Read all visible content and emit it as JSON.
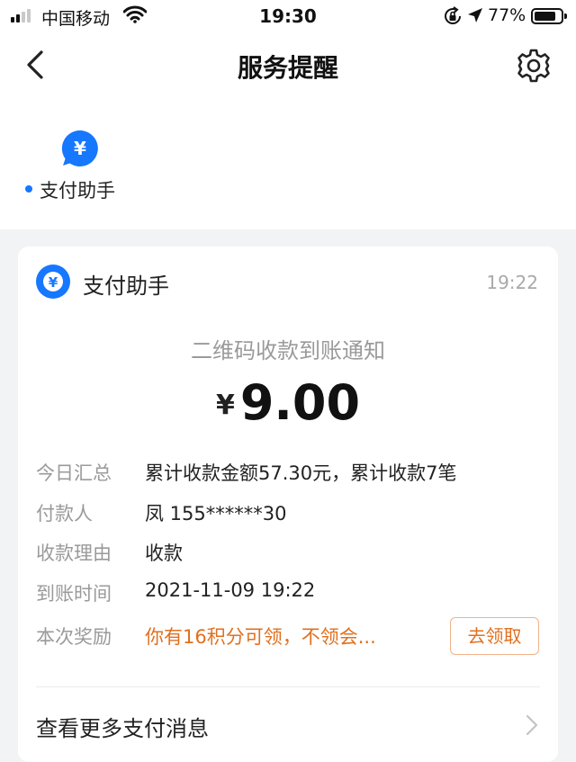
{
  "status_bar": {
    "carrier": "中国移动",
    "time": "19:30",
    "battery_percent": "77%"
  },
  "nav": {
    "title": "服务提醒"
  },
  "service": {
    "label": "支付助手",
    "icon_glyph": "¥"
  },
  "card": {
    "sender": "支付助手",
    "time": "19:22",
    "icon_glyph": "¥",
    "subtitle": "二维码收款到账通知",
    "currency_symbol": "¥",
    "amount": "9.00",
    "details": [
      {
        "label": "今日汇总",
        "value": "累计收款金额57.30元，累计收款7笔"
      },
      {
        "label": "付款人",
        "value": "凤 155******30"
      },
      {
        "label": "收款理由",
        "value": "收款"
      },
      {
        "label": "到账时间",
        "value": "2021-11-09 19:22"
      },
      {
        "label": "本次奖励",
        "value": "你有16积分可领，不领会..."
      }
    ],
    "claim_button": "去领取",
    "more_link": "查看更多支付消息"
  },
  "colors": {
    "brand_blue": "#1677ff",
    "reward_orange": "#e0701f",
    "page_background": "#f2f3f5"
  },
  "icons": [
    "signal-icon",
    "wifi-icon",
    "rotation-lock-icon",
    "location-arrow-icon",
    "battery-icon",
    "back-arrow-icon",
    "gear-icon",
    "yuan-chat-icon",
    "yuan-circle-icon",
    "chevron-right-icon"
  ]
}
